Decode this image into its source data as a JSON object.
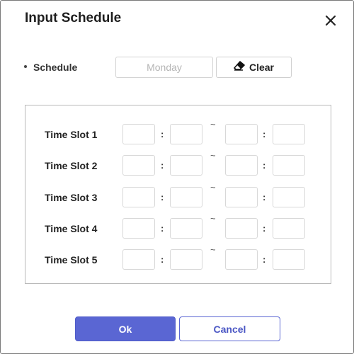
{
  "dialog": {
    "title": "Input Schedule",
    "close_icon": "close-icon"
  },
  "schedule": {
    "label": "Schedule",
    "day_value": "Monday",
    "clear_label": "Clear",
    "clear_icon": "eraser-icon"
  },
  "time_slots": [
    {
      "label": "Time Slot 1",
      "start_hour": "",
      "start_minute": "",
      "end_hour": "",
      "end_minute": ""
    },
    {
      "label": "Time Slot 2",
      "start_hour": "",
      "start_minute": "",
      "end_hour": "",
      "end_minute": ""
    },
    {
      "label": "Time Slot 3",
      "start_hour": "",
      "start_minute": "",
      "end_hour": "",
      "end_minute": ""
    },
    {
      "label": "Time Slot 4",
      "start_hour": "",
      "start_minute": "",
      "end_hour": "",
      "end_minute": ""
    },
    {
      "label": "Time Slot 5",
      "start_hour": "",
      "start_minute": "",
      "end_hour": "",
      "end_minute": ""
    }
  ],
  "separators": {
    "colon": ":",
    "range": "~"
  },
  "buttons": {
    "ok_label": "Ok",
    "cancel_label": "Cancel"
  },
  "colors": {
    "primary": "#5a66d3",
    "border": "#d8d8d8",
    "text": "#222222"
  }
}
